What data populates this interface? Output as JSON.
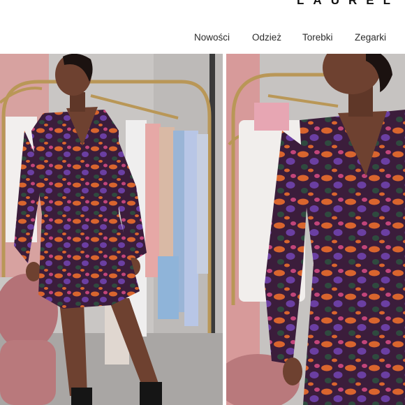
{
  "header": {
    "logo_text": "LAUREL",
    "nav": [
      {
        "label": "Nowości"
      },
      {
        "label": "Odzież"
      },
      {
        "label": "Torebki"
      },
      {
        "label": "Zegarki"
      }
    ]
  },
  "gallery": {
    "photos": [
      {
        "subject": "model-full-length-dress"
      },
      {
        "subject": "model-close-up-dress"
      }
    ]
  },
  "colors": {
    "wall": "#c7c3c0",
    "pink_wall": "#d79a9a",
    "gold_rack": "#b99757",
    "velvet_chair": "#b9797c",
    "dress_base": "#3b1d3b",
    "dress_orange": "#d9652e",
    "dress_purple": "#6b3fa2",
    "dress_green": "#2f4a3f",
    "skin": "#6e4130"
  }
}
